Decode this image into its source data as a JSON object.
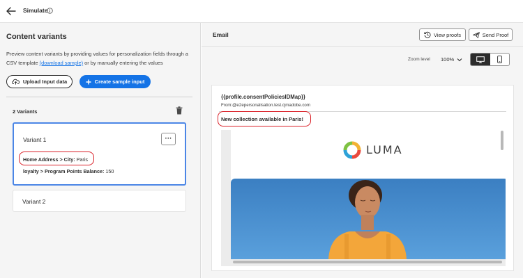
{
  "topbar": {
    "title": "Simulate"
  },
  "left": {
    "title": "Content variants",
    "description_pre": "Preview content variants by providing values for personalization fields through a CSV template ",
    "description_link": "(download sample)",
    "description_post": " or by manually entering the values",
    "upload_label": "Upload Input data",
    "create_label": "Create sample input",
    "variants_count": "2 Variants",
    "variants": [
      {
        "title": "Variant 1",
        "more_label": "···",
        "fields": [
          {
            "key": "Home Address > City:",
            "value": " Paris"
          },
          {
            "key": "loyalty > Program Points Balance:",
            "value": " 150"
          }
        ]
      },
      {
        "title": "Variant 2"
      }
    ]
  },
  "right": {
    "header_title": "Email",
    "view_proofs_label": "View proofs",
    "send_proof_label": "Send Proof",
    "zoom_label": "Zoom level",
    "zoom_value": "100%",
    "preview": {
      "subject": "{{profile.consentPoliciesIDMap}}",
      "from": "From:@e2epersonalisation.test.cjmadobe.com",
      "preheader": "New collection available in Paris!",
      "brand_name": "LUMA"
    }
  },
  "colors": {
    "accent": "#1473e6",
    "highlight": "#d91f26",
    "selected_border": "#4b86e6"
  }
}
